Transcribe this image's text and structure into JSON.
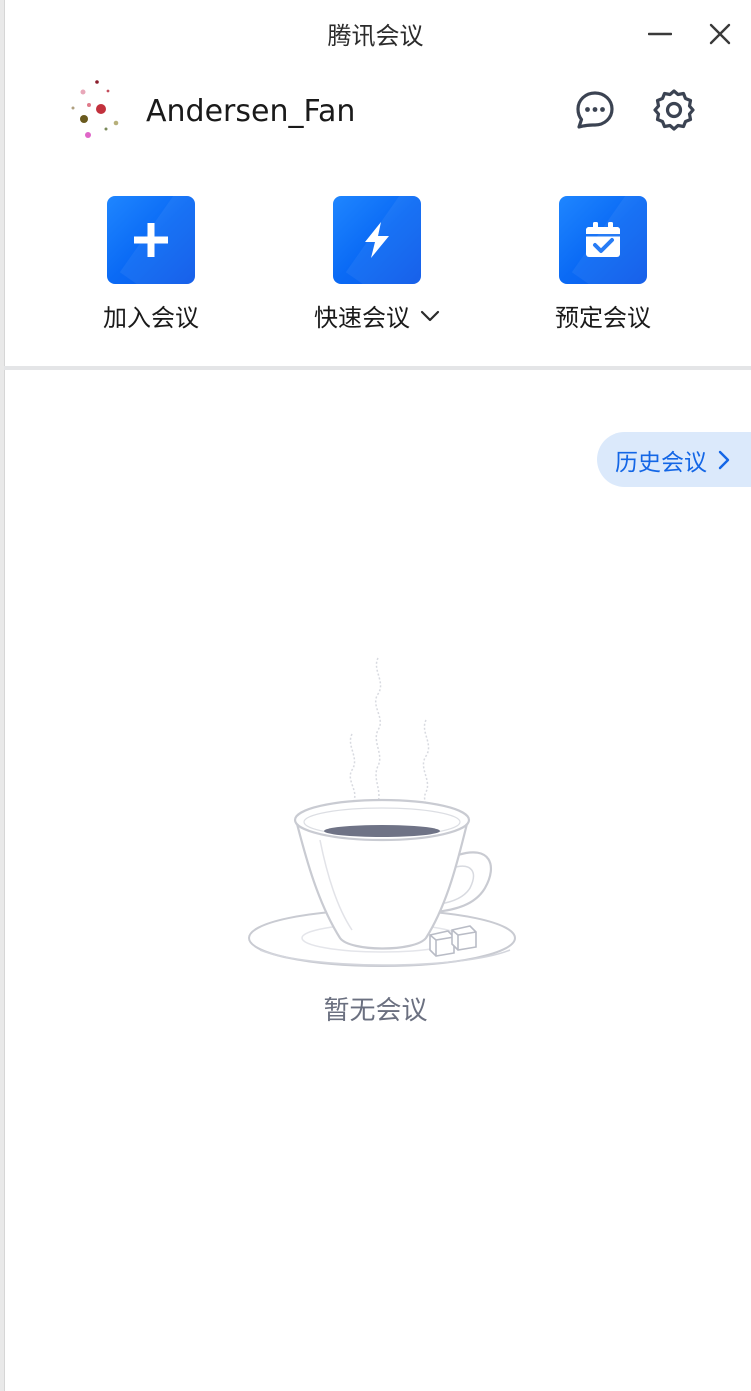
{
  "window": {
    "title": "腾讯会议",
    "minimize_icon": "minimize-icon",
    "close_icon": "close-icon"
  },
  "profile": {
    "username": "Andersen_Fan",
    "avatar_icon": "avatar-dots"
  },
  "header_actions": {
    "messages_icon": "chat-bubble-icon",
    "settings_icon": "gear-icon"
  },
  "actions": {
    "join": {
      "label": "加入会议",
      "icon": "plus-icon"
    },
    "quick": {
      "label": "快速会议",
      "icon": "lightning-icon",
      "dropdown_icon": "chevron-down-icon"
    },
    "schedule": {
      "label": "预定会议",
      "icon": "calendar-check-icon"
    }
  },
  "history": {
    "label": "历史会议",
    "icon": "chevron-right-icon"
  },
  "empty_state": {
    "text": "暂无会议",
    "illustration": "coffee-cup-illustration"
  },
  "colors": {
    "accent": "#0a6af5",
    "history_bg": "#dbe9fb",
    "history_text": "#1366e6",
    "divider": "#e4e5e7",
    "muted_text": "#6b7080"
  }
}
